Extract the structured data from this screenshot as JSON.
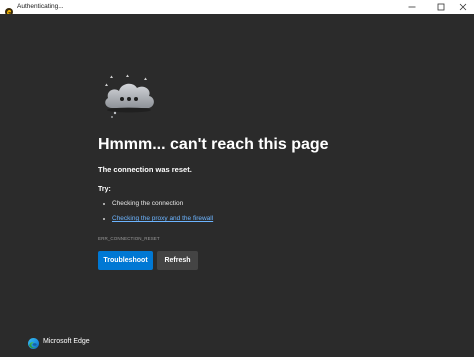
{
  "window": {
    "title": "Authenticating..."
  },
  "icons": {
    "app": "edge-icon",
    "minimize": "minimize-icon",
    "maximize": "maximize-icon",
    "close": "close-icon",
    "illustration": "cloud-icon",
    "brand": "edge-logo"
  },
  "error_page": {
    "headline": "Hmmm... can't reach this page",
    "subhead": "The connection was reset.",
    "try_label": "Try:",
    "tips": [
      {
        "text": "Checking the connection",
        "is_link": false
      },
      {
        "text": "Checking the proxy and the firewall",
        "is_link": true
      }
    ],
    "error_code": "ERR_CONNECTION_RESET",
    "troubleshoot_label": "Troubleshoot",
    "refresh_label": "Refresh"
  },
  "footer": {
    "brand": "Microsoft Edge"
  },
  "colors": {
    "background": "#2b2b2b",
    "primary_button": "#0078d4",
    "secondary_button": "#444444",
    "link": "#6cb4ff"
  }
}
